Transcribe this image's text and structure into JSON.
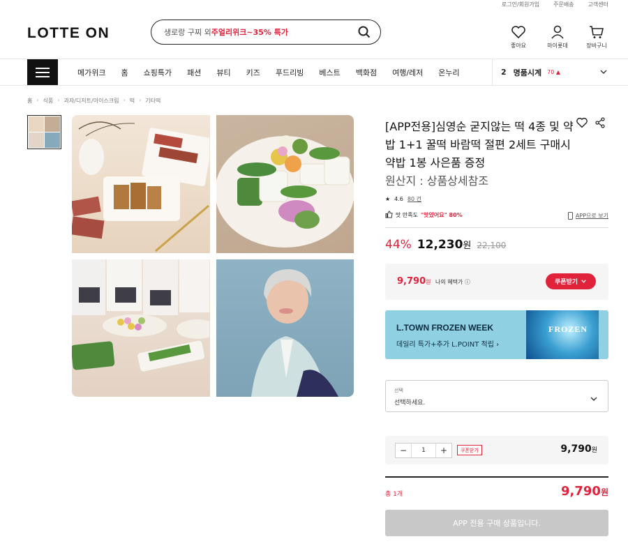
{
  "util": {
    "login": "로그인/회원가입",
    "delivery": "주문배송",
    "support": "고객센터"
  },
  "header": {
    "logo": "LOTTE ON",
    "search_prefix": "생로랑 구찌 외 ",
    "search_highlight": "주얼리위크~35% 특가",
    "icons": [
      {
        "label": "좋아요",
        "icon": "heart-icon"
      },
      {
        "label": "마이롯데",
        "icon": "person-icon"
      },
      {
        "label": "장바구니",
        "icon": "cart-icon"
      }
    ]
  },
  "nav": {
    "items": [
      "메가위크",
      "홈",
      "쇼핑특가",
      "패션",
      "뷰티",
      "키즈",
      "푸드리빙",
      "베스트",
      "백화점",
      "여행/레저",
      "온누리"
    ],
    "rank_num": "2",
    "rank_label": "명품시계",
    "rank_count": "70 ▲"
  },
  "breadcrumb": [
    "홈",
    "식품",
    "과자/디저트/아이스크림",
    "떡",
    "기타떡"
  ],
  "product": {
    "title": "[APP전용]심영순 굳지않는 떡 4종 및 약밥 1+1 꿀떡 바람떡 절편 2세트 구매시 약밥 1봉 사은품 증정",
    "origin": "원산지 : 상품상세참조",
    "rating": "4.6",
    "reviews": "80 건",
    "satisfaction_prefix": "맛 만족도",
    "satisfaction_value": "\"맛있어요\" 80%",
    "app_view": "APP으로 보기",
    "discount": "44%",
    "sale_price": "12,230",
    "sale_unit": "원",
    "original_price": "22,100"
  },
  "benefit": {
    "price": "9,790",
    "unit": "원",
    "label": "나의 혜택가",
    "coupon_button": "쿠폰받기"
  },
  "banner": {
    "title": "L.TOWN FROZEN WEEK",
    "subtitle": "데일리 특가+추가 L.POINT 적립 ›",
    "art_text": "FROZEN",
    "bg": "#8fd1e3"
  },
  "option": {
    "label": "선택",
    "placeholder": "선택하세요."
  },
  "quantity": {
    "minus": "−",
    "value": "1",
    "plus": "+",
    "coupon_tag": "쿠폰받기",
    "price": "9,790",
    "unit": "원"
  },
  "total": {
    "label": "총 1개",
    "price": "9,790",
    "unit": "원"
  },
  "buy_button": "APP 전용 구매 상품입니다.",
  "colors": {
    "accent": "#e0223a",
    "disabled": "#c8c8c8"
  }
}
